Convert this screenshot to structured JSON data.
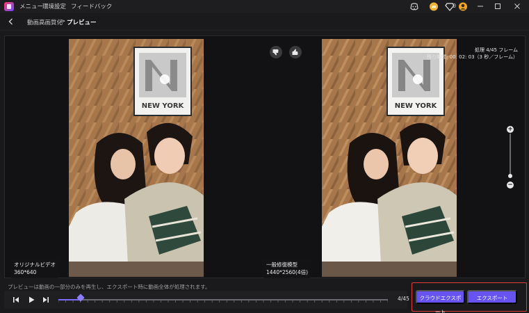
{
  "titlebar": {
    "menu": [
      "メニュー",
      "環境設定",
      "フィードバック"
    ],
    "credits": "0"
  },
  "breadcrumb": {
    "parent": "動画高画質化",
    "separator": ">",
    "current": "プレビュー"
  },
  "preview": {
    "left_label_title": "オリジナルビデオ",
    "left_label_size": "360*640",
    "right_label_title": "一般修復模型",
    "right_label_size": "1440*2560(4倍)",
    "poster_text": "NEW YORK",
    "progress_line1": "処理 4/45 フレーム",
    "progress_line2": "残り時間: 00: 02: 03（3 秒／フレーム）"
  },
  "bottom": {
    "notice": "プレビューは動画の一部分のみを再生し、エクスポート時に動画全体が処理されます。",
    "frame_count": "4/45",
    "progress": 0.0667,
    "cloud_export_label": "クラウドエクスポート",
    "export_label": "エクスポート"
  },
  "colors": {
    "accent": "#6653f2",
    "highlight_border": "#e23b3b"
  },
  "icons": [
    "app-logo-icon",
    "discord-icon",
    "crown-icon",
    "gem-icon",
    "avatar-icon",
    "minimize-icon",
    "maximize-icon",
    "close-icon",
    "back-arrow-icon",
    "thumbs-down-icon",
    "thumbs-up-icon",
    "zoom-in-icon",
    "zoom-out-icon",
    "prev-frame-icon",
    "play-icon",
    "next-frame-icon"
  ]
}
